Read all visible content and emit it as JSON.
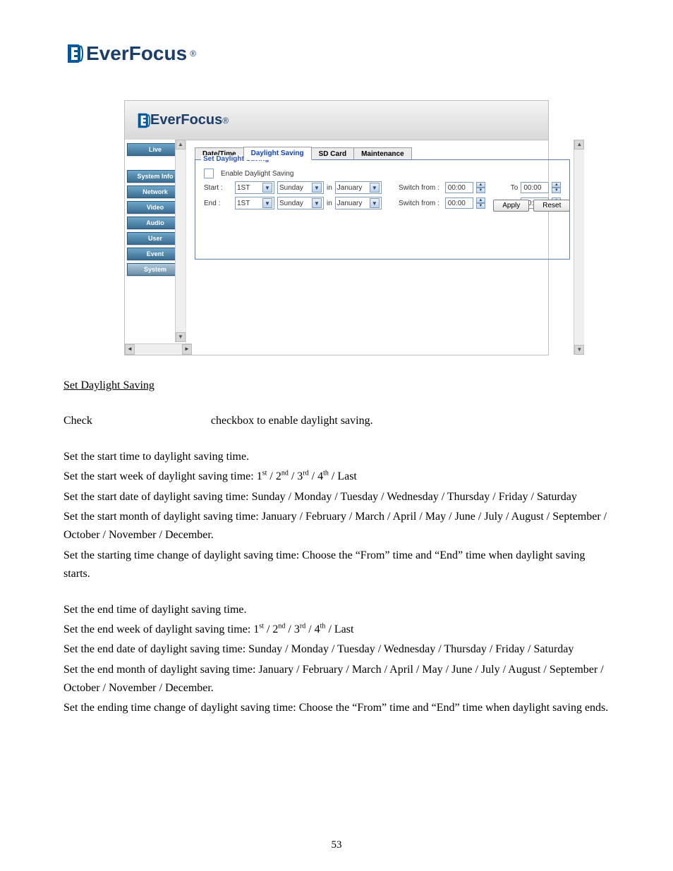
{
  "logo": {
    "brand_prefix": "Ever",
    "brand_suffix": "Focus",
    "reg": "®"
  },
  "screenshot": {
    "nav": {
      "live": "Live",
      "system_info": "System Info",
      "network": "Network",
      "video": "Video",
      "audio": "Audio",
      "user": "User",
      "event": "Event",
      "system": "System"
    },
    "tabs": {
      "datetime": "Date/Time",
      "daylight": "Daylight Saving",
      "sdcard": "SD Card",
      "maintenance": "Maintenance"
    },
    "fieldset": {
      "legend": "Set Daylight Saving",
      "enable_label": "Enable Daylight Saving",
      "start_label": "Start :",
      "end_label": "End :",
      "week_val": "1ST",
      "day_val": "Sunday",
      "in_label": "in",
      "month_val": "January",
      "switch_label": "Switch from :",
      "from_val": "00:00",
      "to_label": "To",
      "to_val": "00:00"
    },
    "buttons": {
      "apply": "Apply",
      "reset": "Reset"
    }
  },
  "doc": {
    "heading": "Set Daylight Saving",
    "check_pre": "Check",
    "check_post": "checkbox to enable daylight saving.",
    "start_intro": "Set the start time to daylight saving time.",
    "start_week": "Set the start week of daylight saving time: 1",
    "start_week_tail": " / Last",
    "start_date": "Set the start date of daylight saving time: Sunday / Monday / Tuesday / Wednesday / Thursday / Friday / Saturday",
    "start_month": "Set the start month of daylight saving time: January / February / March / April / May / June / July / August / September / October / November / December.",
    "start_change": "Set the starting time change of daylight saving time: Choose the “From” time and “End” time when daylight saving starts.",
    "end_intro": "Set the end time of daylight saving time.",
    "end_week": "Set the end week of daylight saving time: 1",
    "end_week_tail": " / Last",
    "end_date": "Set the end date of daylight saving time:  Sunday / Monday / Tuesday / Wednesday / Thursday / Friday / Saturday",
    "end_month": "Set the end month of daylight saving time: January / February / March / April / May / June / July / August / September / October / November / December.",
    "end_change": "Set the ending time change of daylight saving time: Choose the “From” time and “End” time when daylight saving ends.",
    "ord2": " / 2",
    "ord3": " / 3",
    "ord4": " / 4",
    "sup_st": "st",
    "sup_nd": "nd",
    "sup_rd": "rd",
    "sup_th": "th"
  },
  "page_number": "53"
}
